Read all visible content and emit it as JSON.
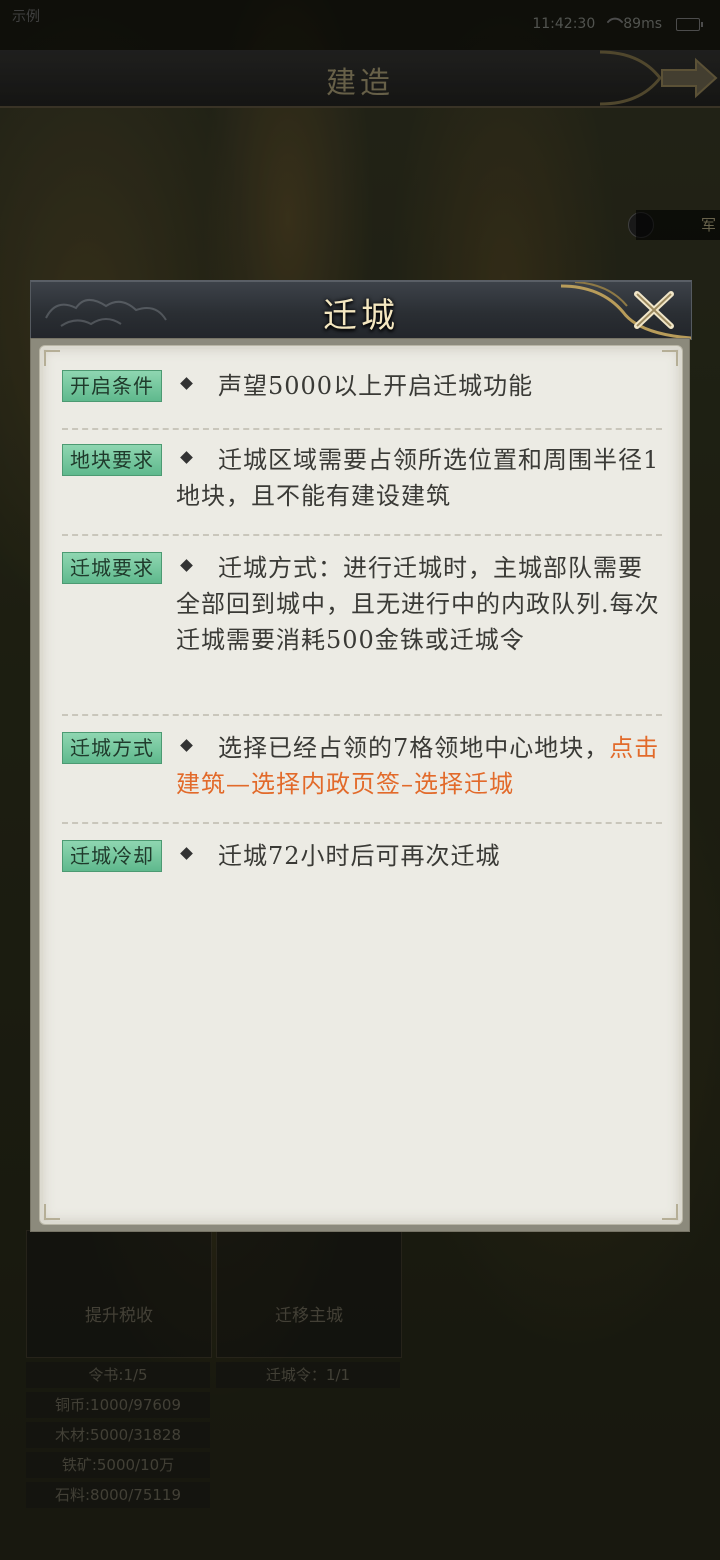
{
  "status_bar": {
    "left_text": "示例",
    "time": "11:42:30",
    "ping": "89ms"
  },
  "top_bar": {
    "title": "建造"
  },
  "side_tag": {
    "label": "军"
  },
  "underlay": {
    "cards": [
      {
        "label": "提升税收"
      },
      {
        "label": "迁移主城"
      }
    ],
    "resources_left": [
      "令书:1/5",
      "铜币:1000/97609",
      "木材:5000/31828",
      "铁矿:5000/10万",
      "石料:8000/75119"
    ],
    "resources_right": [
      "迁城令：1/1"
    ]
  },
  "dialog": {
    "title": "迁城",
    "sections": [
      {
        "tag": "开启条件",
        "text": "声望5000以上开启迁城功能",
        "highlight": ""
      },
      {
        "tag": "地块要求",
        "text": "迁城区域需要占领所选位置和周围半径1地块，且不能有建设建筑",
        "highlight": ""
      },
      {
        "tag": "迁城要求",
        "text": "迁城方式：进行迁城时，主城部队需要全部回到城中，且无进行中的内政队列.每次迁城需要消耗500金铢或迁城令",
        "highlight": ""
      },
      {
        "tag": "迁城方式",
        "text": "选择已经占领的7格领地中心地块，",
        "highlight": "点击建筑—选择内政页签–选择迁城"
      },
      {
        "tag": "迁城冷却",
        "text": "迁城72小时后可再次迁城",
        "highlight": ""
      }
    ]
  },
  "colors": {
    "tag_green": "#6cc497",
    "highlight_orange": "#e26a2a",
    "title_gold": "#f4e7c0",
    "paper": "#ecebe4"
  },
  "icons": {
    "close": "crossed-swords-close-icon",
    "back": "arrow-right-icon"
  }
}
